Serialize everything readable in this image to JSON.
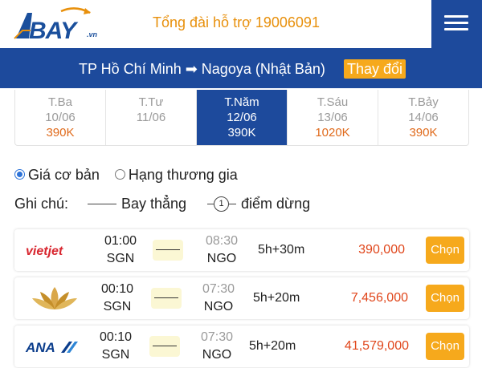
{
  "header": {
    "logo_text": "BAY",
    "logo_suffix": ".vn",
    "hotline": "Tổng đài hỗ trợ 19006091"
  },
  "route": {
    "text": "TP Hồ Chí Minh ➡ Nagoya (Nhật Bản)",
    "change_label": "Thay đổi"
  },
  "dates": [
    {
      "day": "T.Ba",
      "date": "10/06",
      "price": "390K"
    },
    {
      "day": "T.Tư",
      "date": "11/06",
      "price": ""
    },
    {
      "day": "T.Năm",
      "date": "12/06",
      "price": "390K"
    },
    {
      "day": "T.Sáu",
      "date": "13/06",
      "price": "1020K"
    },
    {
      "day": "T.Bảy",
      "date": "14/06",
      "price": "390K"
    }
  ],
  "classes": {
    "basic": "Giá cơ bản",
    "business": "Hạng thương gia"
  },
  "note": {
    "label": "Ghi chú:",
    "direct": "Bay thẳng",
    "stop_number": "1",
    "stop": "điểm dừng"
  },
  "flights": [
    {
      "airline": "vietjet",
      "dep_time": "01:00",
      "dep_code": "SGN",
      "arr_time": "08:30",
      "arr_code": "NGO",
      "duration": "5h+30m",
      "price": "390,000",
      "choose": "Chọn"
    },
    {
      "airline": "vietnam-airlines",
      "dep_time": "00:10",
      "dep_code": "SGN",
      "arr_time": "07:30",
      "arr_code": "NGO",
      "duration": "5h+20m",
      "price": "7,456,000",
      "choose": "Chọn"
    },
    {
      "airline": "ana",
      "dep_time": "00:10",
      "dep_code": "SGN",
      "arr_time": "07:30",
      "arr_code": "NGO",
      "duration": "5h+20m",
      "price": "41,579,000",
      "choose": "Chọn"
    }
  ],
  "logos": {
    "vietjet": "vietjet",
    "ana": "ANA"
  },
  "colors": {
    "brand_blue": "#1d4a9c",
    "accent_orange": "#f6a91c",
    "price_red": "#e0461b"
  }
}
